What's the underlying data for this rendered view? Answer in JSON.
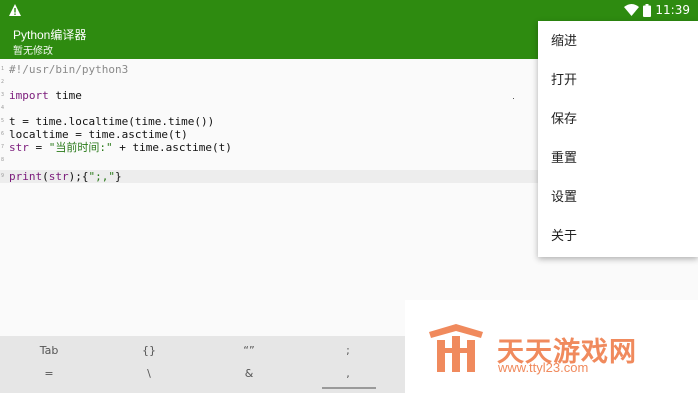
{
  "status_bar": {
    "time": "11:39",
    "icons": [
      "warning-icon",
      "wifi-icon",
      "battery-icon"
    ]
  },
  "app_bar": {
    "title": "Python编译器",
    "subtitle": "暂无修改"
  },
  "editor": {
    "lines": [
      {
        "num": "1",
        "text": "#!/usr/bin/python3"
      },
      {
        "num": "2",
        "text": ""
      },
      {
        "num": "3",
        "text": "import time"
      },
      {
        "num": "4",
        "text": ""
      },
      {
        "num": "5",
        "text": "t = time.localtime(time.time())"
      },
      {
        "num": "6",
        "text": "localtime = time.asctime(t)"
      },
      {
        "num": "7",
        "text": "str = \"当前时间:\" + time.asctime(t)"
      },
      {
        "num": "8",
        "text": ""
      },
      {
        "num": "9",
        "text": "print(str);{\";,\"}"
      }
    ]
  },
  "keybar": {
    "row1": [
      "Tab",
      "{}",
      "“”",
      ";"
    ],
    "row2": [
      "=",
      "\\",
      "&",
      ","
    ]
  },
  "menu": {
    "items": [
      "缩进",
      "打开",
      "保存",
      "重置",
      "设置",
      "关于"
    ]
  },
  "watermark": {
    "name": "天天游戏网",
    "url": "www.ttyl23.com"
  },
  "colors": {
    "primary": "#2e8b10",
    "watermark": "#f08a5d"
  }
}
